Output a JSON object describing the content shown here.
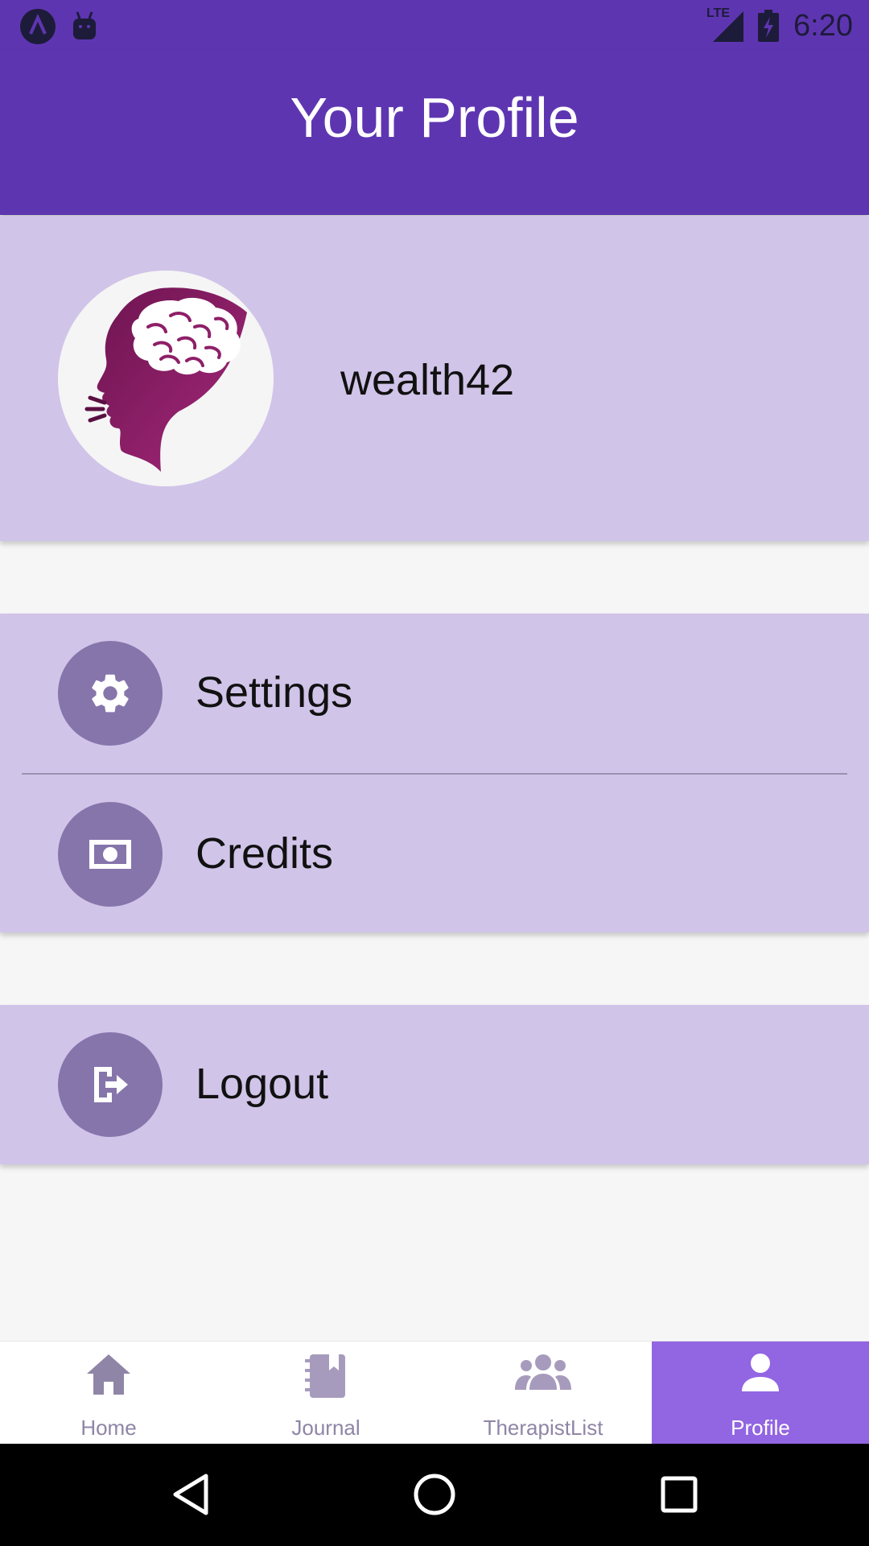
{
  "status_bar": {
    "time": "6:20",
    "network": "LTE"
  },
  "app_bar": {
    "title": "Your Profile"
  },
  "profile": {
    "username": "wealth42"
  },
  "menu": {
    "settings_label": "Settings",
    "credits_label": "Credits",
    "logout_label": "Logout"
  },
  "bottom_nav": {
    "items": [
      {
        "label": "Home",
        "icon": "home-icon"
      },
      {
        "label": "Journal",
        "icon": "journal-icon"
      },
      {
        "label": "TherapistList",
        "icon": "group-icon"
      },
      {
        "label": "Profile",
        "icon": "person-icon",
        "active": true
      }
    ]
  },
  "colors": {
    "primary": "#5e35b1",
    "card": "#d1c4e9",
    "icon_circle": "#8675ab",
    "active_tab": "#9265e2",
    "avatar_brain": "#8e1f68"
  }
}
